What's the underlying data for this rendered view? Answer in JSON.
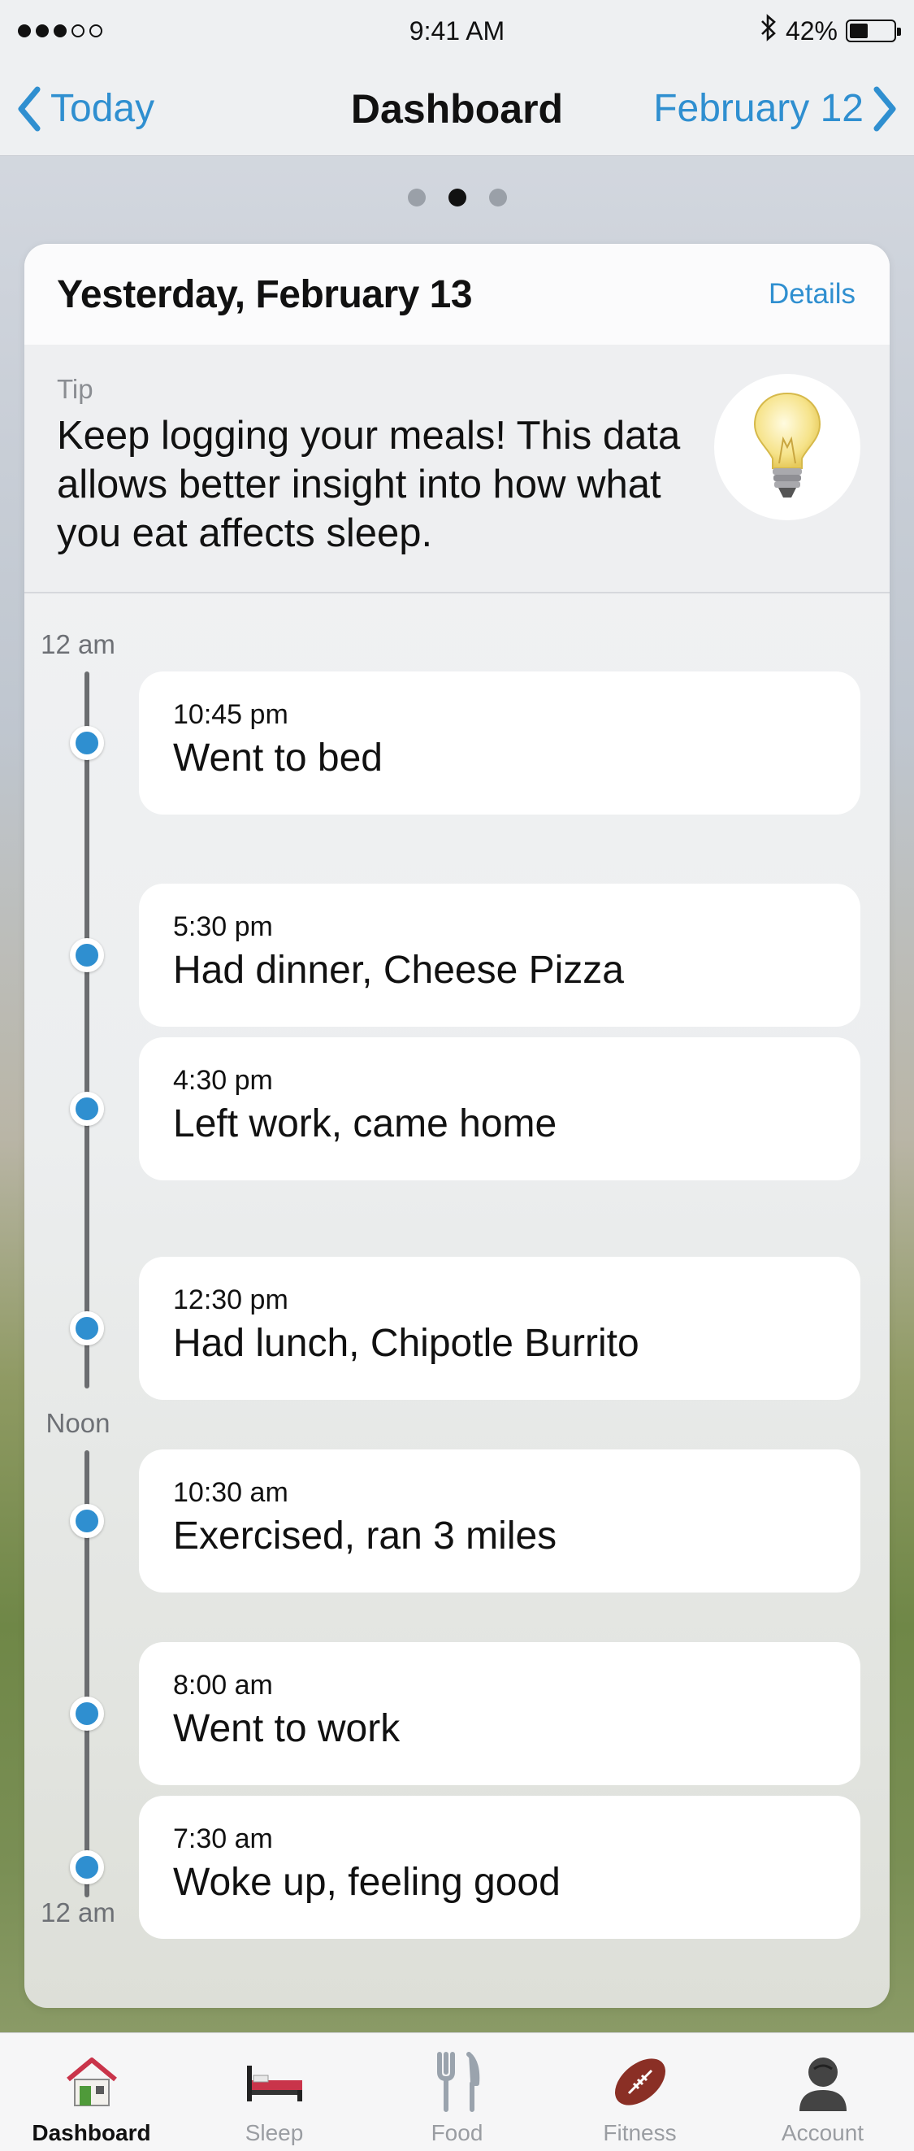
{
  "status_bar": {
    "time": "9:41 AM",
    "battery": "42%",
    "battery_level": 0.42,
    "signal_bars_filled": 3,
    "signal_bars_total": 5,
    "bluetooth_icon": "bluetooth-icon"
  },
  "nav": {
    "back_label": "Today",
    "title": "Dashboard",
    "forward_label": "February 12"
  },
  "pager": {
    "count": 3,
    "active": 1
  },
  "card": {
    "title": "Yesterday, February 13",
    "details_label": "Details",
    "tip": {
      "label": "Tip",
      "text": "Keep logging your meals! This data allows better insight into how what you eat affects sleep.",
      "icon": "lightbulb-icon"
    }
  },
  "timeline": {
    "top_label": "12 am",
    "noon_label": "Noon",
    "bottom_label": "12 am",
    "events": [
      {
        "time": "10:45 pm",
        "desc": "Went to bed"
      },
      {
        "time": "5:30 pm",
        "desc": "Had dinner, Cheese Pizza"
      },
      {
        "time": "4:30 pm",
        "desc": "Left work, came home"
      },
      {
        "time": "12:30 pm",
        "desc": "Had lunch, Chipotle Burrito"
      },
      {
        "time": "10:30 am",
        "desc": "Exercised, ran 3 miles"
      },
      {
        "time": "8:00 am",
        "desc": "Went to work"
      },
      {
        "time": "7:30 am",
        "desc": "Woke up, feeling good"
      }
    ]
  },
  "tabs": [
    {
      "label": "Dashboard",
      "icon": "house-icon",
      "active": true
    },
    {
      "label": "Sleep",
      "icon": "bed-icon",
      "active": false
    },
    {
      "label": "Food",
      "icon": "fork-knife-icon",
      "active": false
    },
    {
      "label": "Fitness",
      "icon": "football-icon",
      "active": false
    },
    {
      "label": "Account",
      "icon": "person-icon",
      "active": false
    }
  ],
  "colors": {
    "accent": "#2f8fd0",
    "timeline_line": "#6b6d70"
  }
}
